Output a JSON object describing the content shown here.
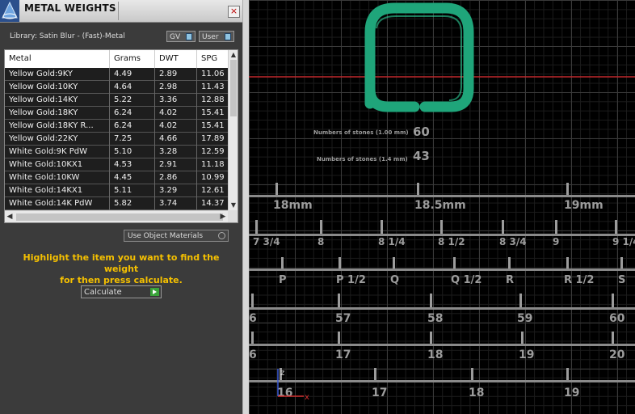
{
  "panel": {
    "title": "METAL WEIGHTS",
    "close_label": "×",
    "library": "Library: Satin Blur - (Fast)-Metal",
    "toggles": {
      "gv": "GV",
      "user": "User"
    },
    "columns": [
      "Metal",
      "Grams",
      "DWT",
      "SPG"
    ],
    "rows": [
      [
        "Yellow Gold:9KY",
        "4.49",
        "2.89",
        "11.06"
      ],
      [
        "Yellow Gold:10KY",
        "4.64",
        "2.98",
        "11.43"
      ],
      [
        "Yellow Gold:14KY",
        "5.22",
        "3.36",
        "12.88"
      ],
      [
        "Yellow Gold:18KY",
        "6.24",
        "4.02",
        "15.41"
      ],
      [
        "Yellow Gold:18KY R...",
        "6.24",
        "4.02",
        "15.41"
      ],
      [
        "Yellow Gold:22KY",
        "7.25",
        "4.66",
        "17.89"
      ],
      [
        "White Gold:9K PdW",
        "5.10",
        "3.28",
        "12.59"
      ],
      [
        "White Gold:10KX1",
        "4.53",
        "2.91",
        "11.18"
      ],
      [
        "White Gold:10KW",
        "4.45",
        "2.86",
        "10.99"
      ],
      [
        "White Gold:14KX1",
        "5.11",
        "3.29",
        "12.61"
      ],
      [
        "White Gold:14K PdW",
        "5.82",
        "3.74",
        "14.37"
      ]
    ],
    "use_object_materials": "Use Object Materials",
    "hint_line1": "Highlight the item you want to find the weight",
    "hint_line2": "for then press calculate.",
    "calculate_label": "Calculate"
  },
  "viewport": {
    "stones": [
      {
        "label": "Numbers of stones (1.00 mm)",
        "count": "60"
      },
      {
        "label": "Numbers of stones (1.4 mm)",
        "count": "43"
      }
    ],
    "rulers": [
      {
        "ticks": [
          "18mm",
          "18.5mm",
          "19mm"
        ]
      },
      {
        "ticks": [
          "7 3/4",
          "8",
          "8 1/4",
          "8 1/2",
          "8 3/4",
          "9",
          "9 1/4"
        ]
      },
      {
        "ticks": [
          "P",
          "P 1/2",
          "Q",
          "Q 1/2",
          "R",
          "R 1/2",
          "S"
        ]
      },
      {
        "ticks": [
          "6",
          "57",
          "58",
          "59",
          "60"
        ]
      },
      {
        "ticks": [
          "6",
          "17",
          "18",
          "19",
          "20"
        ]
      },
      {
        "ticks": [
          "16",
          "17",
          "18",
          "19"
        ]
      }
    ],
    "axis": {
      "z": "z",
      "x": "x"
    },
    "colors": {
      "ring": "#1fa57a",
      "red_line": "#c0282c",
      "hint": "#f5c000"
    }
  }
}
